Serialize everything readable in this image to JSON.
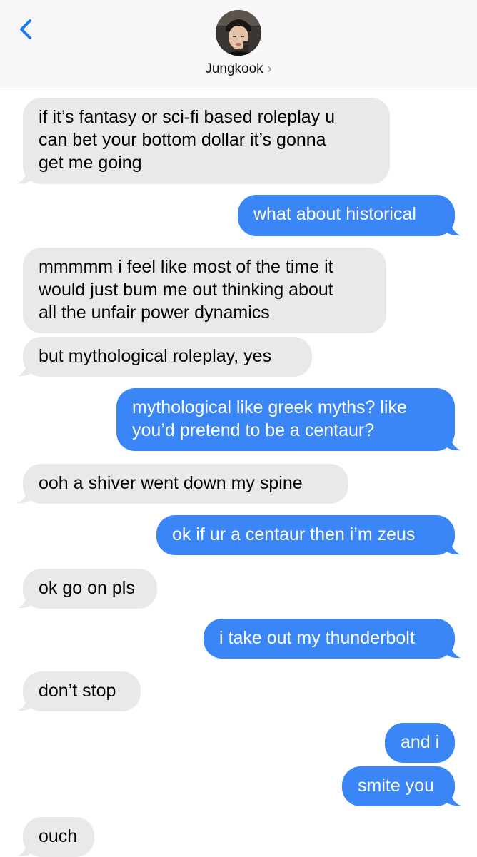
{
  "header": {
    "back_label": "Back",
    "contact_name": "Jungkook",
    "chevron": "›"
  },
  "colors": {
    "incoming_bubble": "#e9e9eb",
    "outgoing_bubble": "#3b86f7",
    "accent": "#1a7cf5",
    "header_bg": "#f7f7f9"
  },
  "messages": [
    {
      "from": "them",
      "lines": [
        "if it’s fantasy or sci-fi based roleplay u",
        "can bet your bottom dollar it’s gonna",
        "get me going"
      ]
    },
    {
      "from": "me",
      "lines": [
        "what about historical"
      ]
    },
    {
      "from": "them",
      "lines": [
        "mmmmm i feel like most of the time it",
        "would just bum me out thinking about",
        "all the unfair power dynamics"
      ]
    },
    {
      "from": "them",
      "lines": [
        "but mythological roleplay, yes"
      ]
    },
    {
      "from": "me",
      "lines": [
        "mythological like greek myths? like",
        "you’d pretend to be a centaur?"
      ]
    },
    {
      "from": "them",
      "lines": [
        "ooh a shiver went down my spine"
      ]
    },
    {
      "from": "me",
      "lines": [
        "ok if ur a centaur then i’m zeus"
      ]
    },
    {
      "from": "them",
      "lines": [
        "ok go on pls"
      ]
    },
    {
      "from": "me",
      "lines": [
        "i take out my thunderbolt"
      ]
    },
    {
      "from": "them",
      "lines": [
        "don’t stop"
      ]
    },
    {
      "from": "me",
      "lines": [
        "and i"
      ]
    },
    {
      "from": "me",
      "lines": [
        "smite you"
      ]
    },
    {
      "from": "them",
      "lines": [
        "ouch"
      ]
    }
  ]
}
